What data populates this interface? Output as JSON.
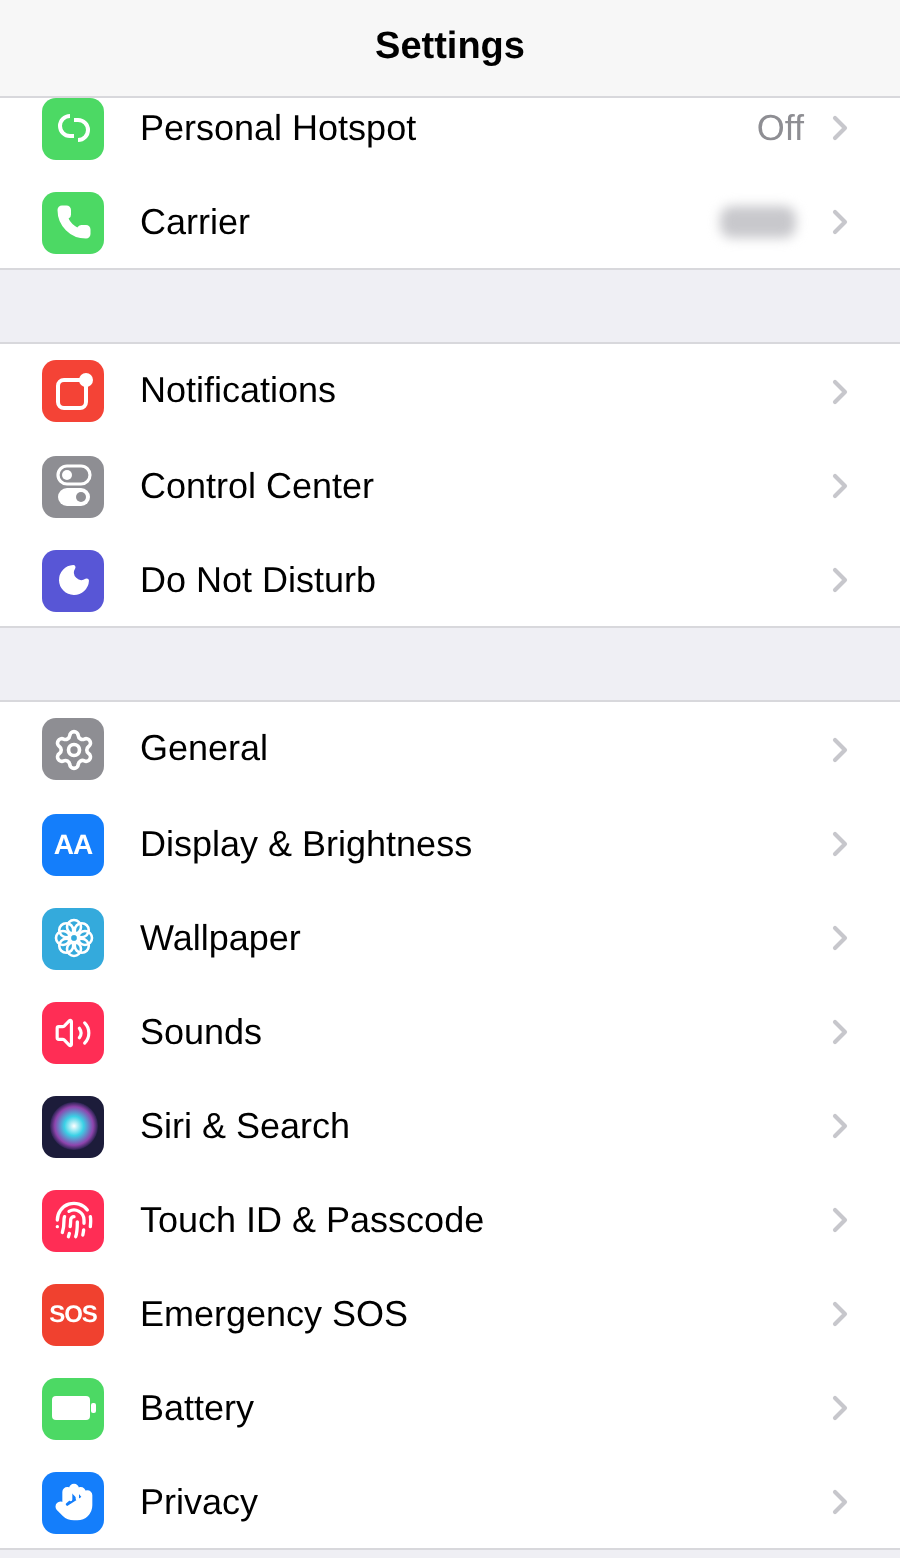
{
  "header": {
    "title": "Settings"
  },
  "groups": [
    {
      "items": [
        {
          "label": "Personal Hotspot",
          "color": "#4cd964",
          "value": "Off"
        },
        {
          "label": "Carrier",
          "color": "#4cd964",
          "value_blurred": true
        }
      ]
    },
    {
      "items": [
        {
          "label": "Notifications",
          "color": "#f44336"
        },
        {
          "label": "Control Center",
          "color": "#8e8e93"
        },
        {
          "label": "Do Not Disturb",
          "color": "#5856d6"
        }
      ]
    },
    {
      "items": [
        {
          "label": "General",
          "color": "#8e8e93"
        },
        {
          "label": "Display & Brightness",
          "icon_text": "AA",
          "color": "#147efb"
        },
        {
          "label": "Wallpaper",
          "color": "#34aadc"
        },
        {
          "label": "Sounds",
          "color": "#ff2d55"
        },
        {
          "label": "Siri & Search",
          "color": "#1c1c3a"
        },
        {
          "label": "Touch ID & Passcode",
          "color": "#ff2d55"
        },
        {
          "label": "Emergency SOS",
          "icon_text": "SOS",
          "color": "#f0412f"
        },
        {
          "label": "Battery",
          "color": "#4cd964"
        },
        {
          "label": "Privacy",
          "color": "#147efb"
        }
      ]
    }
  ]
}
